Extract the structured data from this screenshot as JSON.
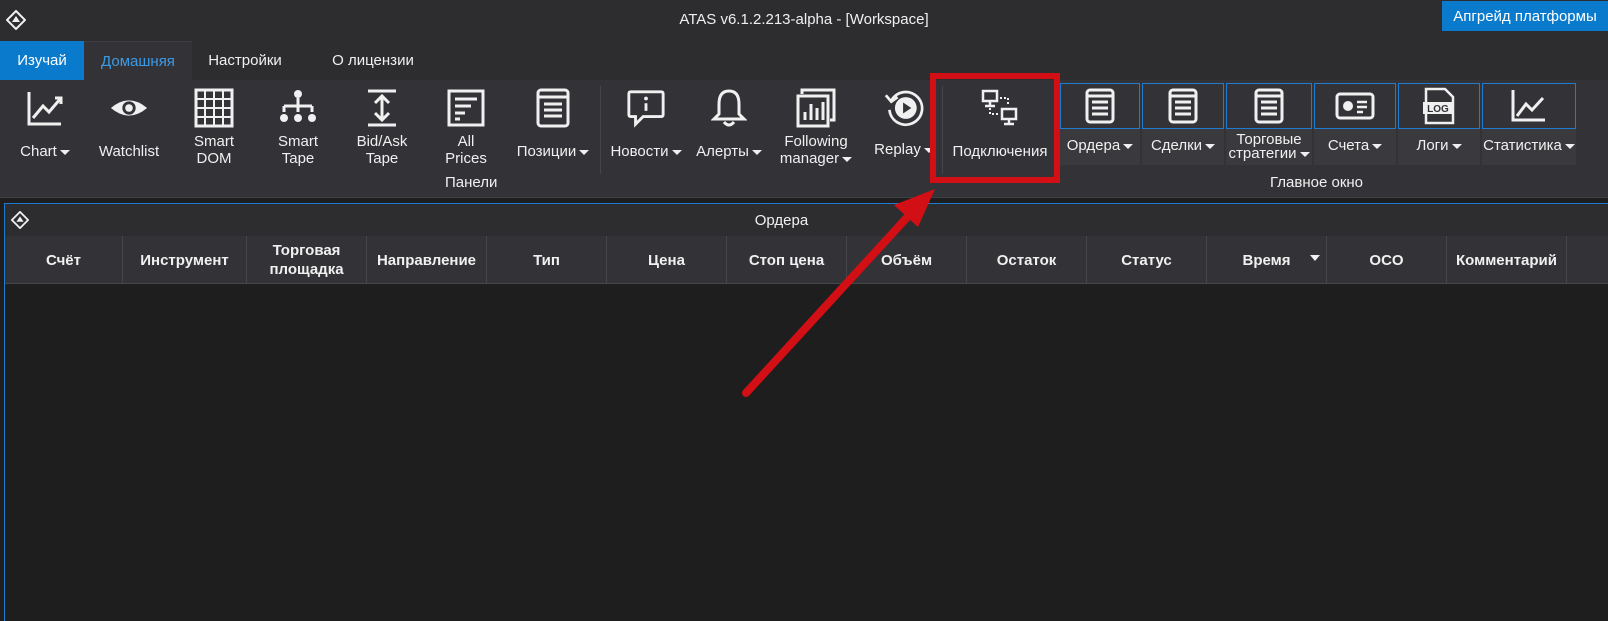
{
  "titlebar": {
    "title": "ATAS v6.1.2.213-alpha - [Workspace]",
    "upgrade_label": "Апгрейд платформы"
  },
  "tabs": [
    {
      "label": "Изучай"
    },
    {
      "label": "Домашняя"
    },
    {
      "label": "Настройки"
    },
    {
      "label": "О лицензии"
    }
  ],
  "ribbon": {
    "panels_group_label": "Панели",
    "main_window_group_label": "Главное окно",
    "buttons": {
      "chart": "Chart",
      "watchlist": "Watchlist",
      "smart_dom_1": "Smart",
      "smart_dom_2": "DOM",
      "smart_tape_1": "Smart",
      "smart_tape_2": "Tape",
      "bidask_1": "Bid/Ask",
      "bidask_2": "Tape",
      "allprices_1": "All",
      "allprices_2": "Prices",
      "positions": "Позиции",
      "news": "Новости",
      "alerts": "Алерты",
      "following_1": "Following",
      "following_2": "manager",
      "replay": "Replay",
      "connections": "Подключения"
    },
    "window_buttons": {
      "orders": "Ордера",
      "trades": "Сделки",
      "strategies_1": "Торговые",
      "strategies_2": "стратегии",
      "accounts": "Счета",
      "logs": "Логи",
      "logs_icon_text": "LOG",
      "statistics": "Статистика"
    }
  },
  "orders_panel": {
    "title": "Ордера",
    "columns": [
      "Счёт",
      "Инструмент",
      "Торговая площадка",
      "Направление",
      "Тип",
      "Цена",
      "Стоп цена",
      "Объём",
      "Остаток",
      "Статус",
      "Время",
      "OCO",
      "Комментарий"
    ],
    "rows": []
  },
  "colors": {
    "accent_blue": "#0a7acc",
    "highlight_red": "#d10f14",
    "background": "#1e1e1e",
    "ribbon": "#333337"
  }
}
